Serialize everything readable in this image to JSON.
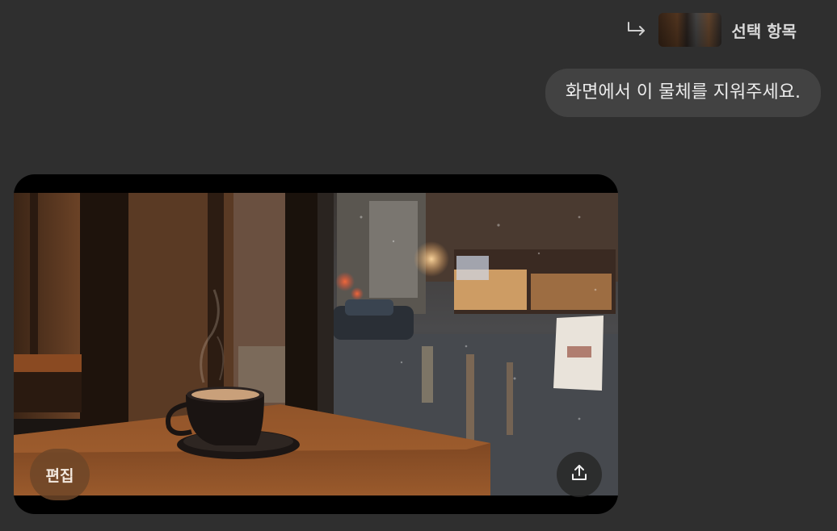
{
  "reference": {
    "label": "선택 항목",
    "icon": "reply-arrow-icon"
  },
  "message": {
    "text": "화면에서 이 물체를 지워주세요."
  },
  "image": {
    "edit_label": "편집",
    "share_icon": "upload-icon"
  }
}
